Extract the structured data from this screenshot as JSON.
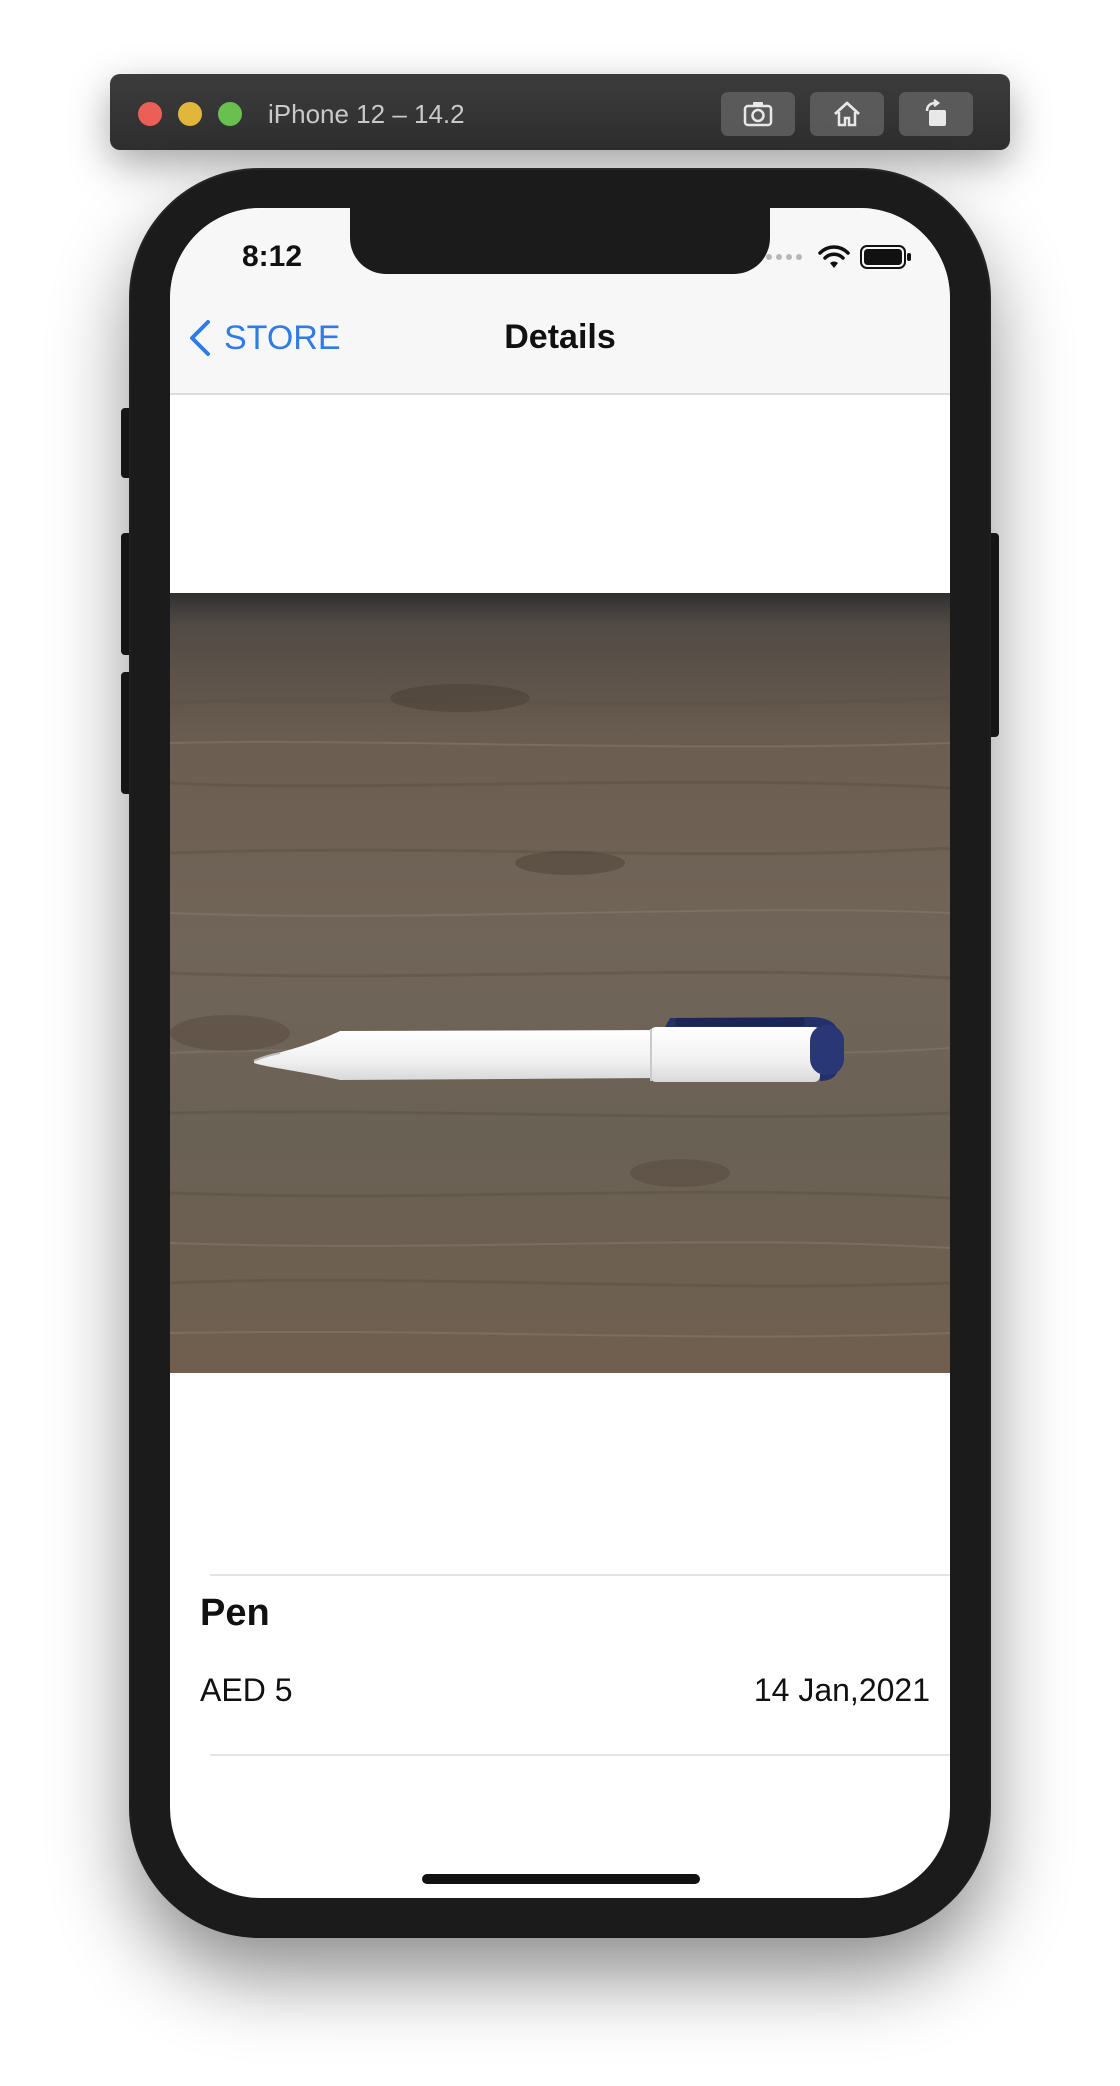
{
  "simulator": {
    "title": "iPhone 12 – 14.2",
    "buttons": [
      "camera-icon",
      "home-icon",
      "rotate-icon"
    ]
  },
  "status_bar": {
    "time": "8:12"
  },
  "navbar": {
    "back_label": "STORE",
    "title": "Details"
  },
  "product": {
    "name": "Pen",
    "price": "AED 5",
    "date": "14 Jan,2021"
  },
  "colors": {
    "accent": "#2f7ce6",
    "device": "#1b1b1c"
  }
}
